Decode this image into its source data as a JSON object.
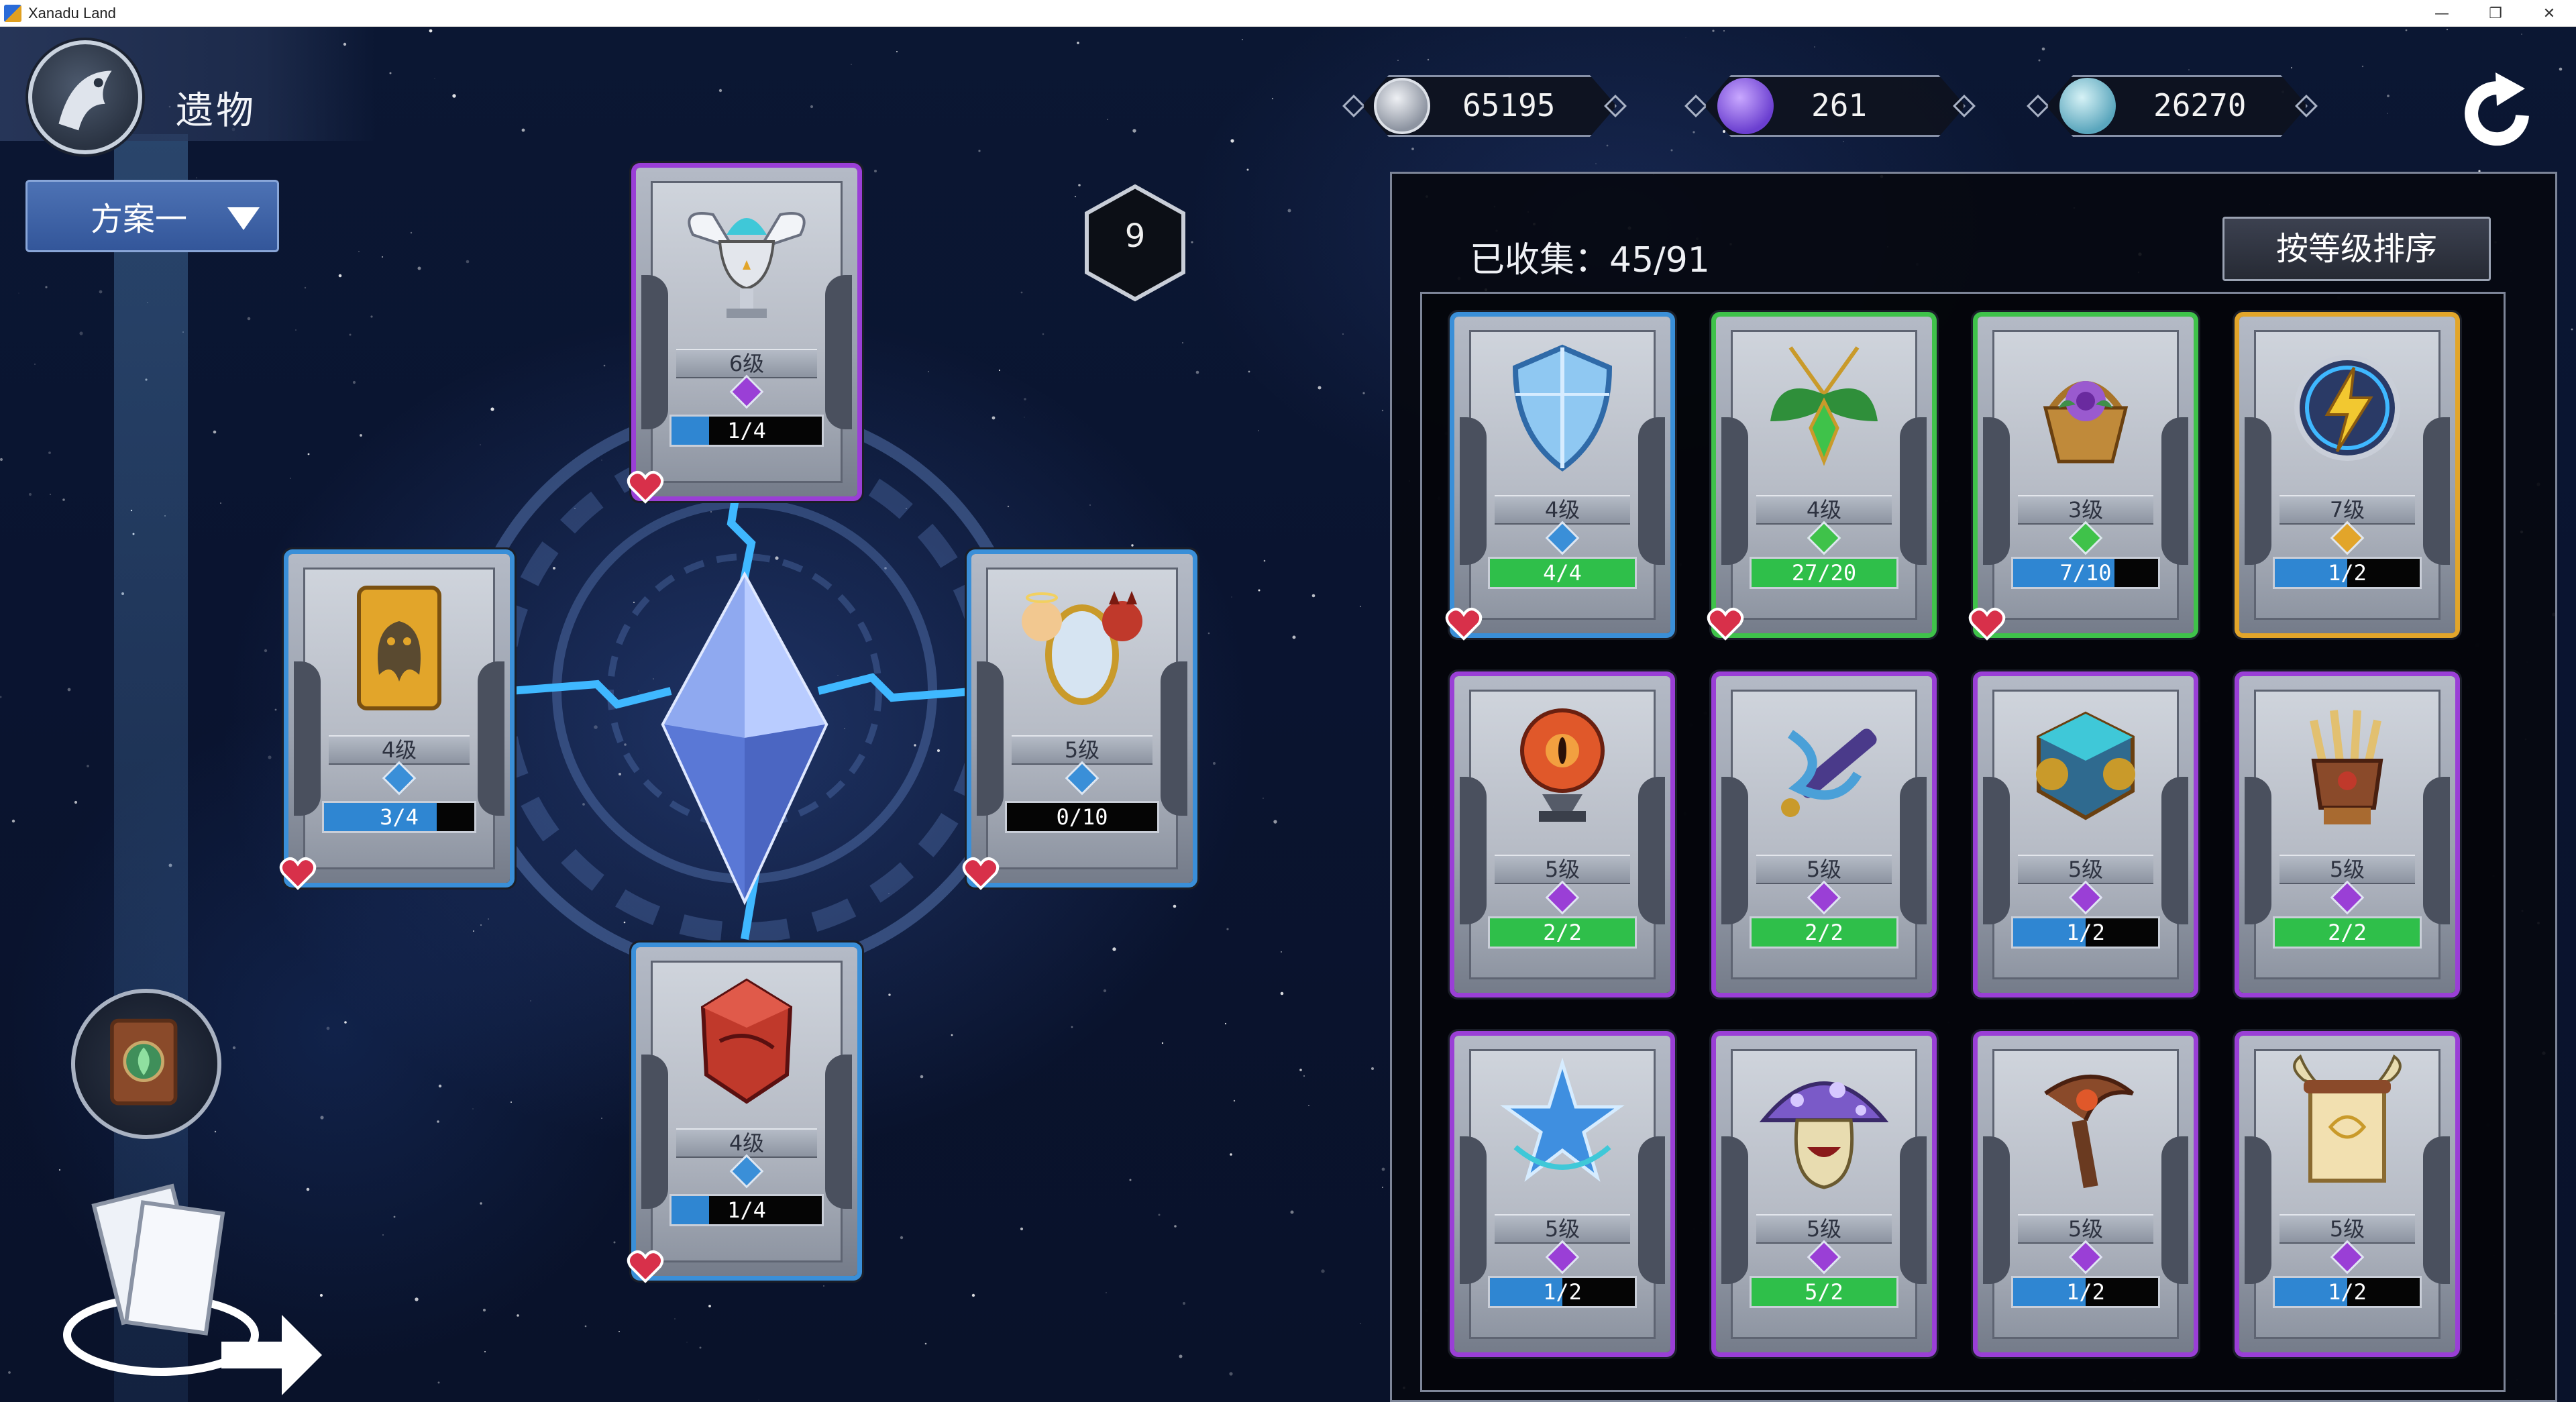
{
  "window": {
    "title": "Xanadu Land",
    "controls": [
      "—",
      "❐",
      "✕"
    ]
  },
  "header": {
    "title": "遗物",
    "emblem_icon": "eagle-crest-icon"
  },
  "scheme_dropdown": {
    "selected": "方案一",
    "caret_icon": "triangle-down-icon"
  },
  "currencies": [
    {
      "name": "silver-coin",
      "icon": "silver-coin-icon",
      "value": "65195",
      "color": "#b9bec8"
    },
    {
      "name": "purple-spirit",
      "icon": "purple-spirit-icon",
      "value": "261",
      "color": "#8a5cf0"
    },
    {
      "name": "teal-spirit",
      "icon": "teal-spirit-icon",
      "value": "26270",
      "color": "#7fc8d8"
    }
  ],
  "refresh_icon": "refresh-arrow-icon",
  "slot_count": "9",
  "equipped": [
    {
      "id": "top",
      "level": "6级",
      "progress": "1/4",
      "fill": 0.25,
      "rarity": "purple",
      "art": "winged-chalice",
      "favorite": true
    },
    {
      "id": "left",
      "level": "4级",
      "progress": "3/4",
      "fill": 0.75,
      "rarity": "blue",
      "art": "ghost-card",
      "favorite": true
    },
    {
      "id": "right",
      "level": "5级",
      "progress": "0/10",
      "fill": 0.0,
      "rarity": "blue",
      "art": "angel-devil-mirror",
      "favorite": true
    },
    {
      "id": "bottom",
      "level": "4级",
      "progress": "1/4",
      "fill": 0.25,
      "rarity": "blue",
      "art": "red-crystal",
      "favorite": true
    }
  ],
  "collection": {
    "collected_label": "已收集：45/91",
    "sort_button": "按等级排序",
    "items": [
      {
        "level": "4级",
        "progress": "4/4",
        "fill": 1.0,
        "bar_color": "green",
        "rarity": "blue",
        "art": "crystal-shield",
        "favorite": true
      },
      {
        "level": "4级",
        "progress": "27/20",
        "fill": 1.0,
        "bar_color": "green",
        "rarity": "green",
        "art": "leaf-amulet",
        "favorite": true
      },
      {
        "level": "3级",
        "progress": "7/10",
        "fill": 0.7,
        "bar_color": "blue",
        "rarity": "green",
        "art": "rose-basket",
        "favorite": true
      },
      {
        "level": "7级",
        "progress": "1/2",
        "fill": 0.5,
        "bar_color": "blue",
        "rarity": "gold",
        "art": "lightning-orb",
        "favorite": false
      },
      {
        "level": "5级",
        "progress": "2/2",
        "fill": 1.0,
        "bar_color": "green",
        "rarity": "purple",
        "art": "eye-orb",
        "favorite": false
      },
      {
        "level": "5级",
        "progress": "2/2",
        "fill": 1.0,
        "bar_color": "green",
        "rarity": "purple",
        "art": "serpent-flute",
        "favorite": false
      },
      {
        "level": "5级",
        "progress": "1/2",
        "fill": 0.5,
        "bar_color": "blue",
        "rarity": "purple",
        "art": "gear-cube",
        "favorite": false
      },
      {
        "level": "5级",
        "progress": "2/2",
        "fill": 1.0,
        "bar_color": "green",
        "rarity": "purple",
        "art": "claw-gauntlet",
        "favorite": false
      },
      {
        "level": "5级",
        "progress": "1/2",
        "fill": 0.5,
        "bar_color": "blue",
        "rarity": "purple",
        "art": "ice-star",
        "favorite": false
      },
      {
        "level": "5级",
        "progress": "5/2",
        "fill": 1.0,
        "bar_color": "green",
        "rarity": "purple",
        "art": "mushroom-monster",
        "favorite": false
      },
      {
        "level": "5级",
        "progress": "1/2",
        "fill": 0.5,
        "bar_color": "blue",
        "rarity": "purple",
        "art": "eye-scythe",
        "favorite": false
      },
      {
        "level": "5级",
        "progress": "1/2",
        "fill": 0.5,
        "bar_color": "blue",
        "rarity": "purple",
        "art": "horned-scroll",
        "favorite": false
      }
    ]
  },
  "colors": {
    "rarity_blue": "#3a8fd8",
    "rarity_green": "#3fc24a",
    "rarity_purple": "#9a3fd6",
    "rarity_gold": "#e2a52a",
    "bar_blue": "#2f86d2",
    "bar_green": "#2fbf4a",
    "favorite_heart": "#d8304a"
  },
  "side_buttons": {
    "book_icon": "leaf-tome-icon",
    "deck_icon": "card-deck-arrow-icon"
  }
}
